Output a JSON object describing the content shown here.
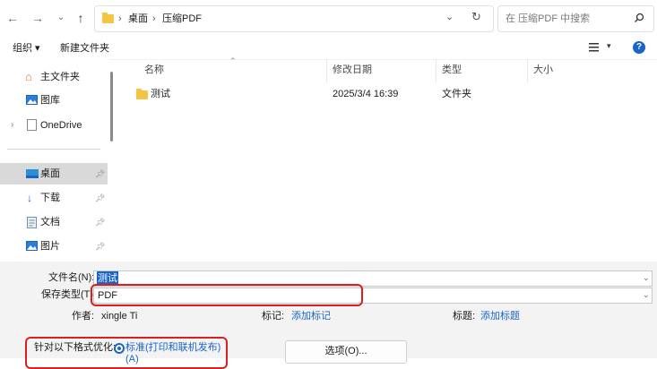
{
  "address": {
    "crumbs": [
      "桌面",
      "压缩PDF"
    ],
    "search_placeholder": "在 压缩PDF 中搜索"
  },
  "toolbar": {
    "organize": "组织 ▾",
    "new_folder": "新建文件夹"
  },
  "nav": {
    "items": [
      {
        "label": "主文件夹",
        "icon": "home-icon"
      },
      {
        "label": "图库",
        "icon": "gallery-icon"
      },
      {
        "label": "OneDrive",
        "icon": "onedrive-icon"
      },
      {
        "label": "桌面",
        "icon": "desktop-icon"
      },
      {
        "label": "下载",
        "icon": "download-icon"
      },
      {
        "label": "文档",
        "icon": "document-icon"
      },
      {
        "label": "图片",
        "icon": "pictures-icon"
      }
    ]
  },
  "columns": {
    "name": "名称",
    "date": "修改日期",
    "type": "类型",
    "size": "大小"
  },
  "files": [
    {
      "name": "测试",
      "date": "2025/3/4 16:39",
      "type": "文件夹",
      "size": ""
    }
  ],
  "form": {
    "filename_label": "文件名(N):",
    "filename_value": "测试",
    "savetype_label": "保存类型(T):",
    "savetype_value": "PDF",
    "author_label": "作者:",
    "author_value": "xingle Ti",
    "tags_label": "标记:",
    "tags_value": "添加标记",
    "title_label": "标题:",
    "title_value": "添加标题",
    "optimize_label": "针对以下格式优化:",
    "optimize_option": "标准(打印和联机发布)",
    "optimize_option_tail": "(A)",
    "options_button": "选项(O)..."
  }
}
